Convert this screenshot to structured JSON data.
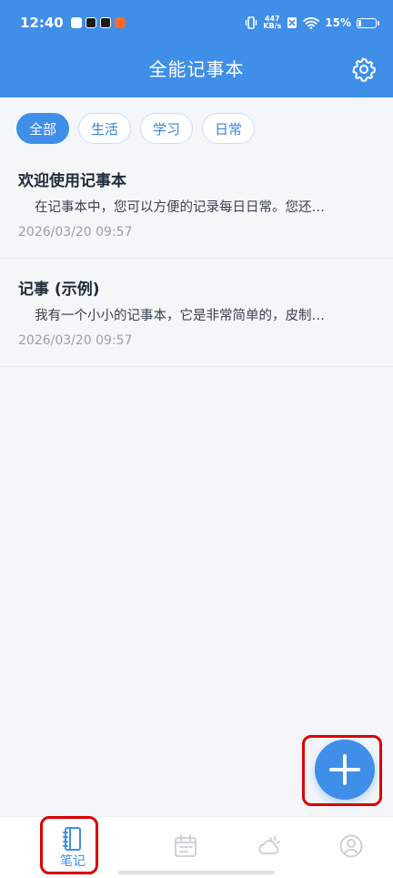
{
  "status_bar": {
    "time": "12:40",
    "net_speed_value": "447",
    "net_speed_unit": "KB/s",
    "battery": "15%",
    "battery_level": 0.15
  },
  "header": {
    "title": "全能记事本",
    "settings_icon": "gear-icon"
  },
  "categories": [
    {
      "label": "全部",
      "active": true
    },
    {
      "label": "生活",
      "active": false
    },
    {
      "label": "学习",
      "active": false
    },
    {
      "label": "日常",
      "active": false
    }
  ],
  "notes": [
    {
      "title": "欢迎使用记事本",
      "preview": "在记事本中，您可以方便的记录每日日常。您还…",
      "date": "2026/03/20 09:57"
    },
    {
      "title": "记事 (示例)",
      "preview": "我有一个小小的记事本，它是非常简单的，皮制…",
      "date": "2026/03/20 09:57"
    }
  ],
  "fab": {
    "icon": "plus-icon"
  },
  "bottom_nav": [
    {
      "label": "笔记",
      "icon": "notebook-icon",
      "active": true
    },
    {
      "label": "",
      "icon": "calendar-icon",
      "active": false
    },
    {
      "label": "",
      "icon": "weather-icon",
      "active": false
    },
    {
      "label": "",
      "icon": "profile-icon",
      "active": false
    }
  ],
  "colors": {
    "primary": "#3f8ee8",
    "highlight_outline": "#d90000"
  }
}
